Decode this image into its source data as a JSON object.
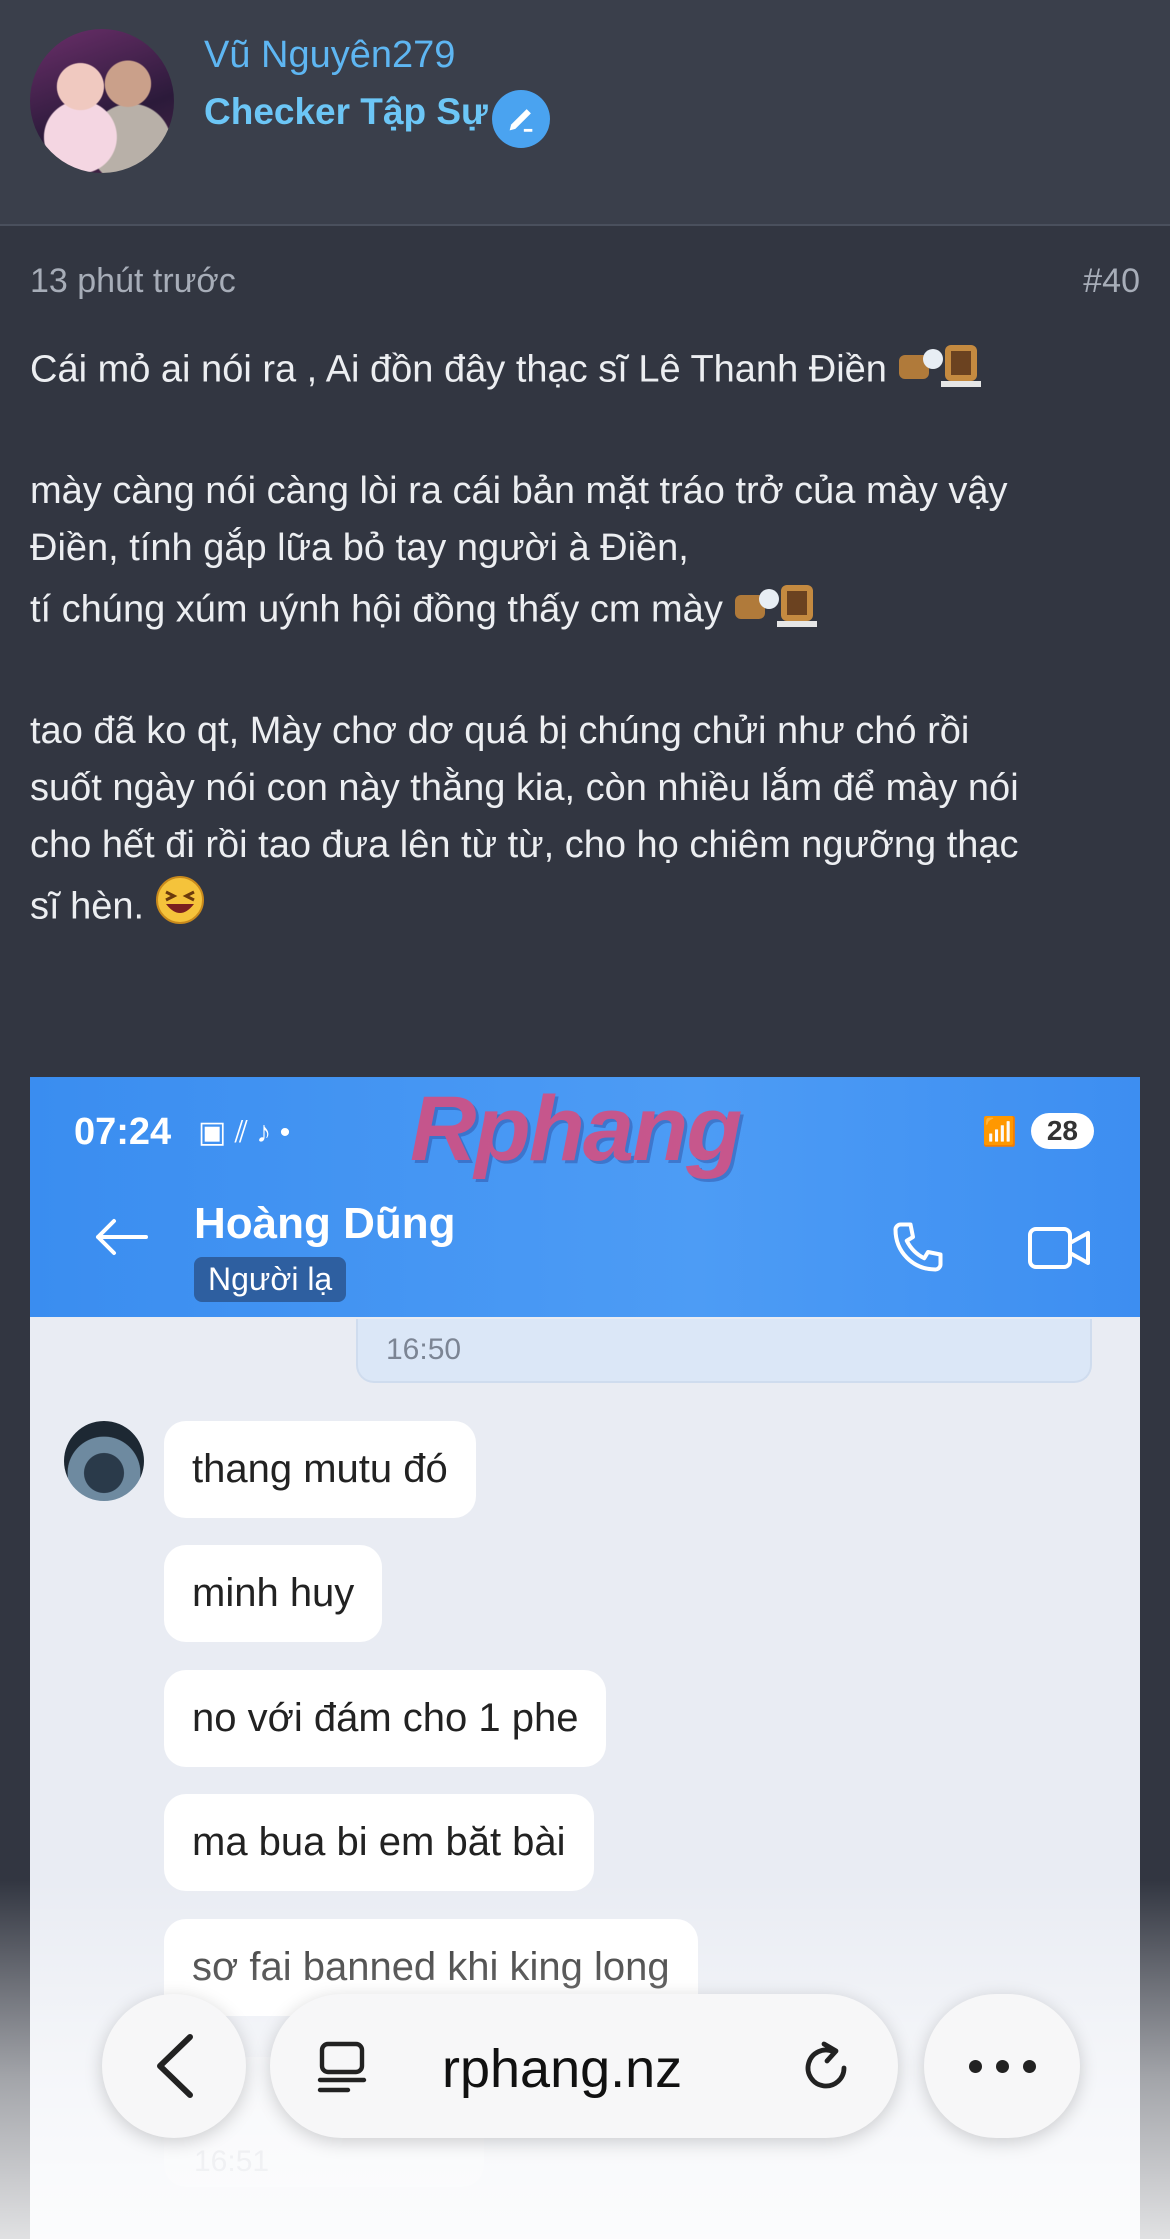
{
  "user": {
    "name": "Vũ Nguyên279",
    "rank": "Checker Tập Sự"
  },
  "post_meta": {
    "time": "13 phút trước",
    "number": "#40"
  },
  "post": {
    "lines": [
      "Cái mỏ ai nói ra , Ai đồn đây thạc sĩ Lê Thanh Điền",
      "mày càng nói càng lòi ra cái bản mặt tráo trở của mày vậy",
      "Điền, tính gắp lữa bỏ tay người à Điền,",
      "tí chúng xúm uýnh hội đồng thấy cm mày",
      "tao đã ko qt, Mày chơ dơ quá bị chúng chửi như chó rồi",
      "suốt ngày nói con này thằng kia, còn nhiều lắm để mày nói",
      "cho hết đi rồi tao đưa lên từ từ, cho họ chiêm ngưỡng thạc",
      "sĩ hèn."
    ]
  },
  "screenshot": {
    "status_time": "07:24",
    "watermark": "Rphang",
    "battery": "28",
    "contact_name": "Hoàng Dũng",
    "contact_tag": "Người lạ",
    "timestamp_top": "16:50",
    "messages": [
      "thang mutu đó",
      "minh huy",
      "no với đám cho 1 phe",
      "ma bua bi em băt bài",
      "sơ fai banned khi king long"
    ],
    "timestamp_bottom": "16:51"
  },
  "browser": {
    "url": "rphang.nz"
  }
}
